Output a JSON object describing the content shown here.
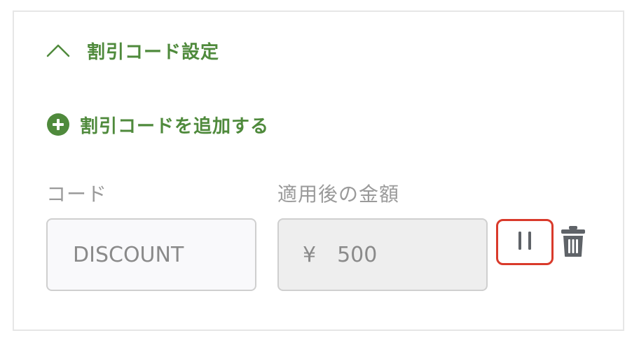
{
  "section": {
    "title": "割引コード設定",
    "expanded": true,
    "chevron_icon": "chevron-up-icon"
  },
  "add_discount": {
    "label": "割引コードを追加する",
    "icon": "plus-circle-icon"
  },
  "fields": {
    "code_label": "コード",
    "amount_label": "適用後の金額",
    "code_placeholder": "DISCOUNT",
    "currency_symbol": "¥",
    "amount_placeholder": "500"
  },
  "actions": {
    "pause_icon": "pause-icon",
    "delete_icon": "trash-icon"
  },
  "colors": {
    "accent": "#4f8a3c",
    "highlight_border": "#d93a2b",
    "icon_gray": "#5f6368",
    "label_gray": "#9a9a9a"
  }
}
